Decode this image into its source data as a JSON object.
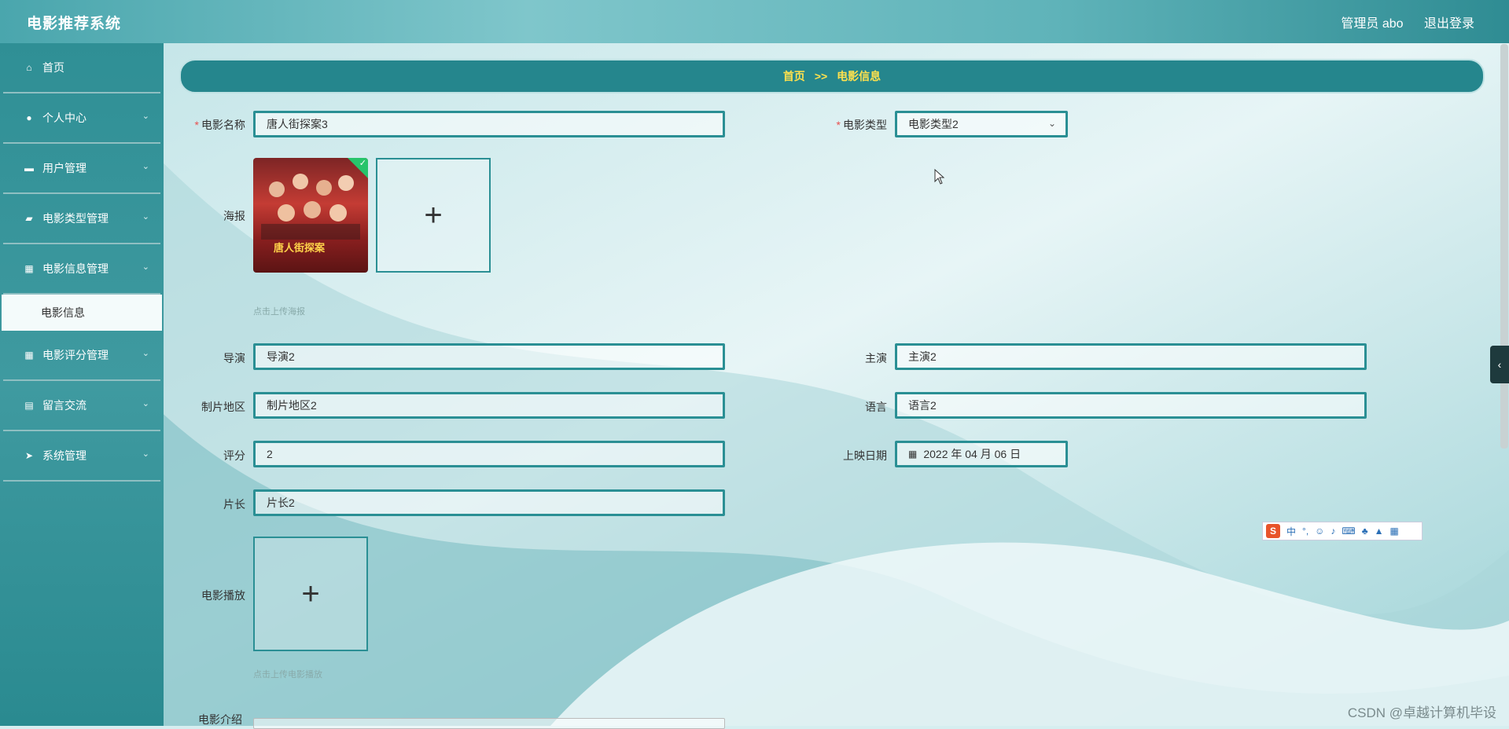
{
  "app": {
    "title": "电影推荐系统"
  },
  "header": {
    "user": "管理员 abo",
    "logout": "退出登录"
  },
  "sidebar": {
    "items": [
      {
        "label": "首页",
        "icon": "home-icon",
        "has_children": false
      },
      {
        "label": "个人中心",
        "icon": "user-icon",
        "has_children": true
      },
      {
        "label": "用户管理",
        "icon": "monitor-icon",
        "has_children": true
      },
      {
        "label": "电影类型管理",
        "icon": "chat-icon",
        "has_children": true
      },
      {
        "label": "电影信息管理",
        "icon": "grid-icon",
        "has_children": true
      },
      {
        "label": "电影评分管理",
        "icon": "grid-icon",
        "has_children": true
      },
      {
        "label": "留言交流",
        "icon": "clipboard-icon",
        "has_children": true
      },
      {
        "label": "系统管理",
        "icon": "send-icon",
        "has_children": true
      }
    ],
    "active_sub": "电影信息"
  },
  "breadcrumb": {
    "home": "首页",
    "separator": ">>",
    "current": "电影信息"
  },
  "form": {
    "name": {
      "label": "电影名称",
      "value": "唐人街探案3",
      "required": true
    },
    "type": {
      "label": "电影类型",
      "value": "电影类型2",
      "required": true
    },
    "poster": {
      "label": "海报",
      "hint": "点击上传海报",
      "poster_text": "唐人街探案"
    },
    "director": {
      "label": "导演",
      "value": "导演2"
    },
    "actor": {
      "label": "主演",
      "value": "主演2"
    },
    "region": {
      "label": "制片地区",
      "value": "制片地区2"
    },
    "language": {
      "label": "语言",
      "value": "语言2"
    },
    "rating": {
      "label": "评分",
      "value": "2"
    },
    "release_date": {
      "label": "上映日期",
      "value": "2022 年 04 月 06 日"
    },
    "duration": {
      "label": "片长",
      "value": "片长2"
    },
    "video": {
      "label": "电影播放",
      "hint": "点击上传电影播放"
    },
    "intro": {
      "label": "电影介绍"
    }
  },
  "ime": {
    "mode": "中"
  },
  "watermark": "CSDN @卓越计算机毕设"
}
